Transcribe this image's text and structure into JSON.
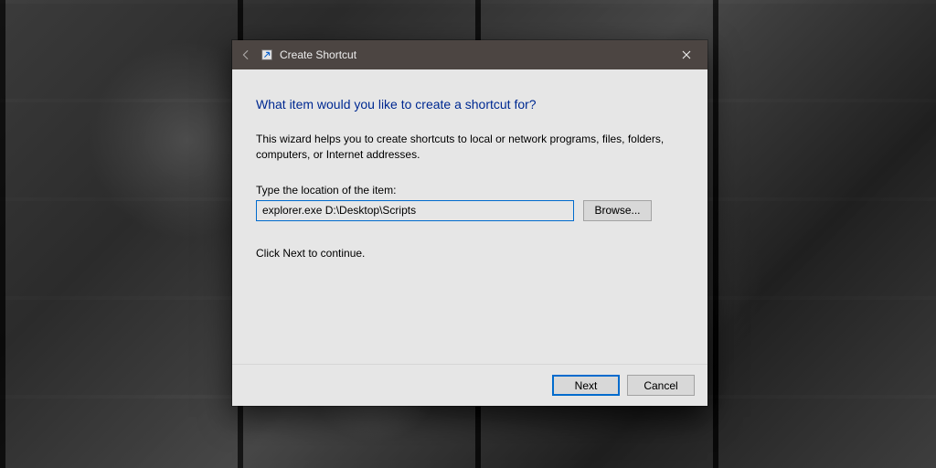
{
  "titlebar": {
    "title": "Create Shortcut"
  },
  "wizard": {
    "heading": "What item would you like to create a shortcut for?",
    "description": "This wizard helps you to create shortcuts to local or network programs, files, folders, computers, or Internet addresses.",
    "location_label": "Type the location of the item:",
    "location_value": "explorer.exe D:\\Desktop\\Scripts",
    "browse_label": "Browse...",
    "continue_text": "Click Next to continue."
  },
  "footer": {
    "next_label": "Next",
    "cancel_label": "Cancel"
  }
}
